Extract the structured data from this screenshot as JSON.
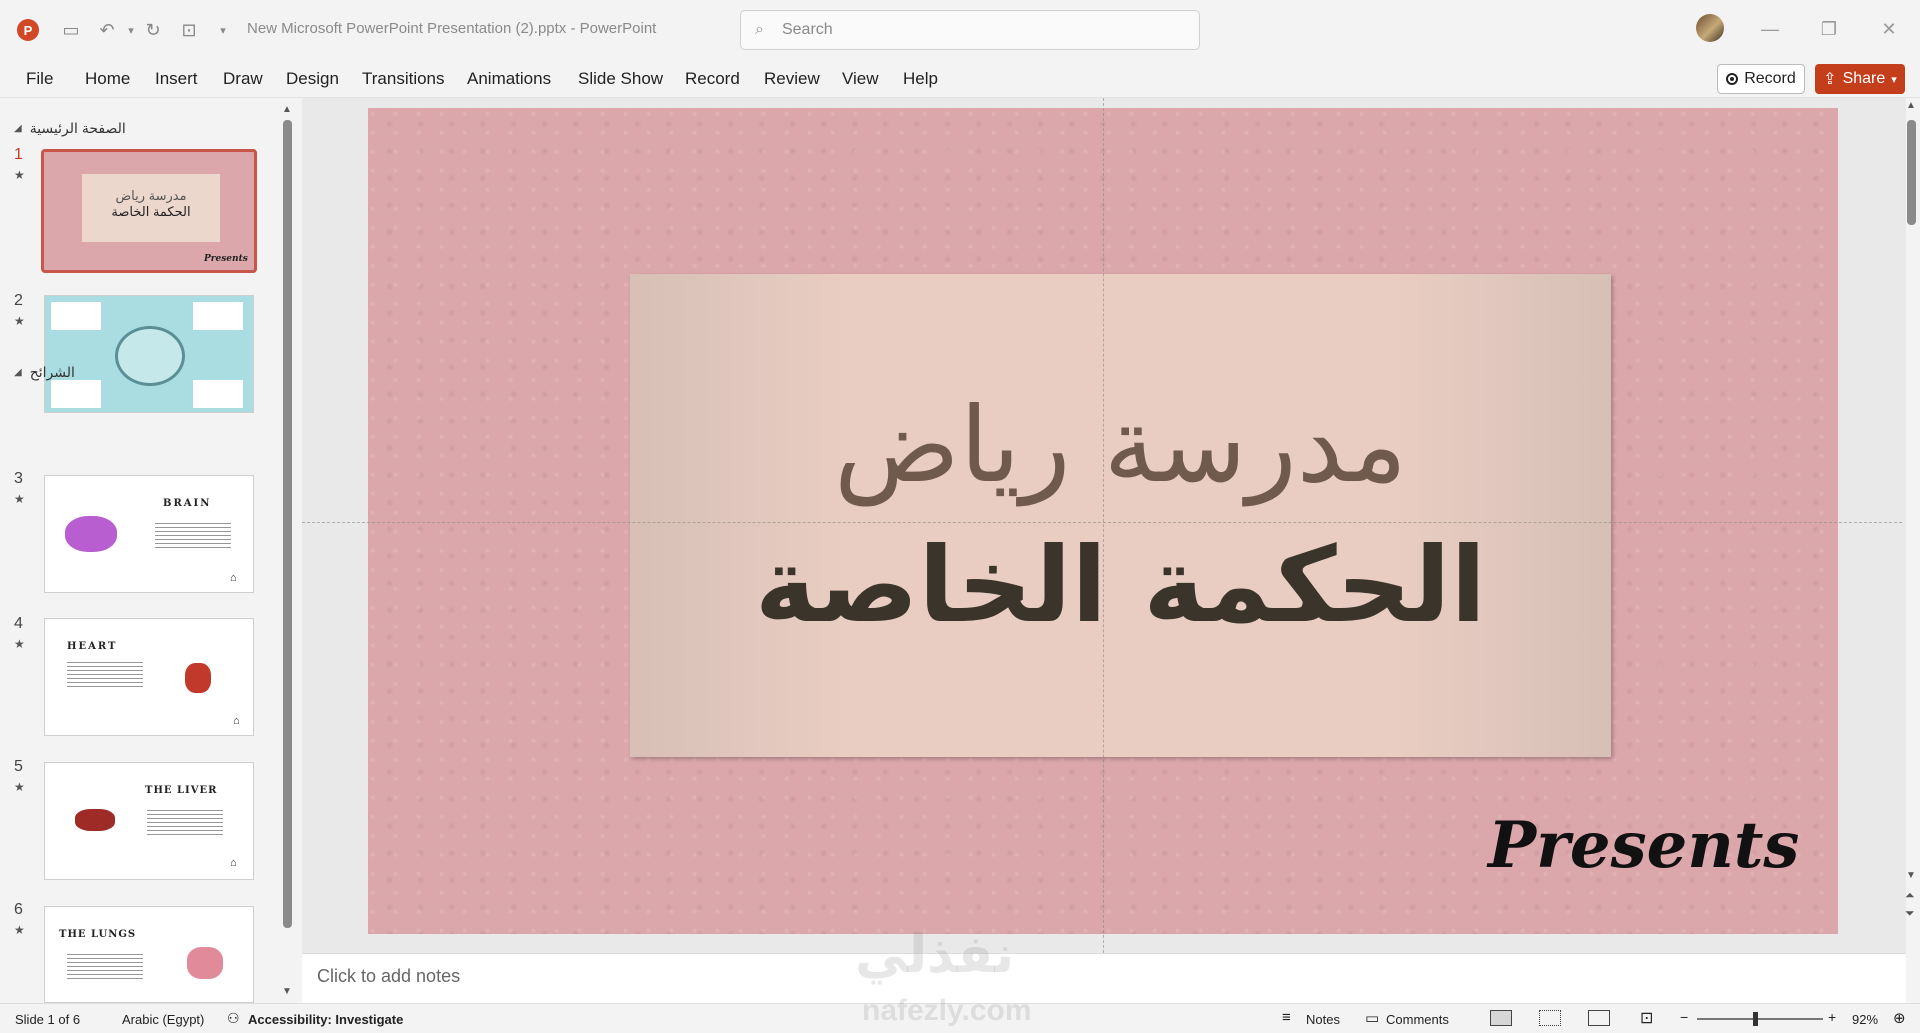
{
  "titlebar": {
    "app_logo": "P",
    "document_title": "New Microsoft PowerPoint Presentation (2).pptx  -  PowerPoint",
    "search_placeholder": "Search"
  },
  "ribbon": {
    "tabs": [
      "File",
      "Home",
      "Insert",
      "Draw",
      "Design",
      "Transitions",
      "Animations",
      "Slide Show",
      "Record",
      "Review",
      "View",
      "Help"
    ],
    "record_label": "Record",
    "share_label": "Share"
  },
  "sections": [
    {
      "label": "الصفحة الرئيسية"
    },
    {
      "label": "الشرائح"
    }
  ],
  "slides": [
    {
      "num": "1",
      "title_line1": "مدرسة رياض",
      "title_line2": "الحكمة الخاصة",
      "caption": "Presents"
    },
    {
      "num": "2"
    },
    {
      "num": "3",
      "heading": "BRAIN"
    },
    {
      "num": "4",
      "heading": "HEART"
    },
    {
      "num": "5",
      "heading": "THE LIVER"
    },
    {
      "num": "6",
      "heading": "THE LUNGS"
    }
  ],
  "current_slide": {
    "title_line1": "مدرسة رياض",
    "title_line2": "الحكمة الخاصة",
    "presents": "Presents",
    "background_color": "#dba7ab"
  },
  "notes_placeholder": "Click to add notes",
  "statusbar": {
    "slide_counter": "Slide 1 of 6",
    "language": "Arabic (Egypt)",
    "accessibility": "Accessibility: Investigate",
    "notes_label": "Notes",
    "comments_label": "Comments",
    "zoom": "92%"
  },
  "watermark": {
    "arabic": "نفذلي",
    "latin": "nafezly.com"
  },
  "colors": {
    "accent": "#c43e1c",
    "slide_bg": "#dba7ab"
  }
}
